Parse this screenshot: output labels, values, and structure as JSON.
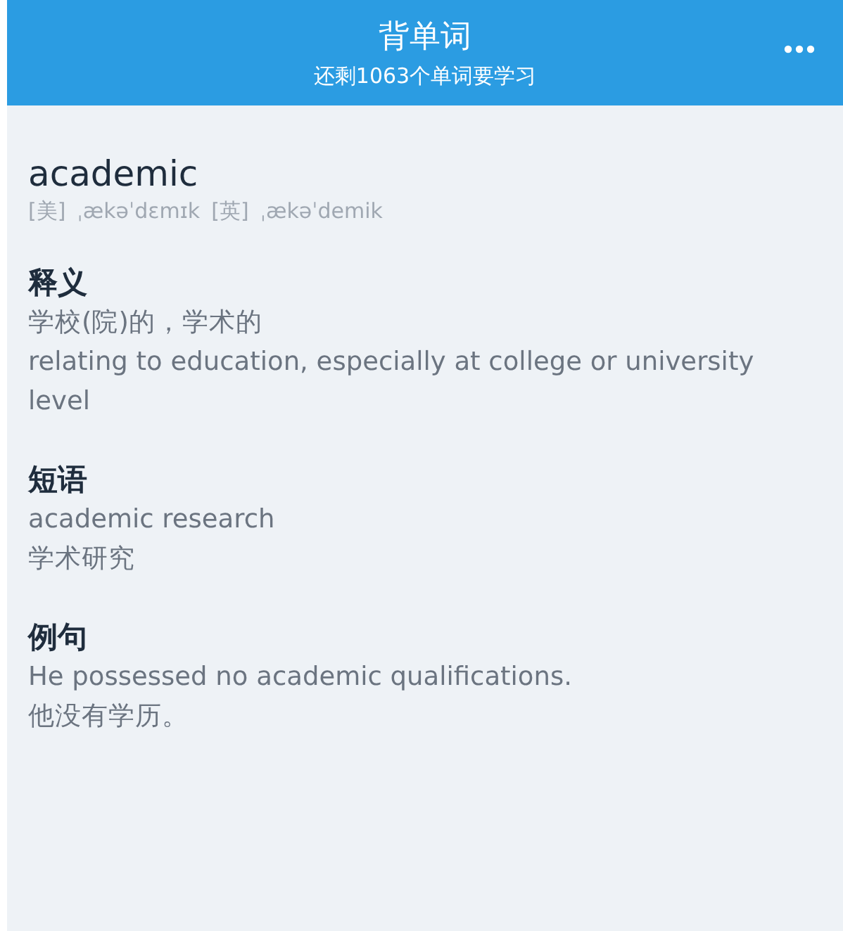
{
  "header": {
    "title": "背单词",
    "subtitle": "还剩1063个单词要学习"
  },
  "word": {
    "text": "academic",
    "phonetics": [
      {
        "region": "[美]",
        "ipa": "ˌækəˈdɛmɪk"
      },
      {
        "region": "[英]",
        "ipa": "ˌækəˈdemik"
      }
    ]
  },
  "sections": [
    {
      "title": "释义",
      "lines": [
        "学校(院)的，学术的",
        "relating to education, especially at college or university level"
      ]
    },
    {
      "title": "短语",
      "lines": [
        "academic research",
        "学术研究"
      ]
    },
    {
      "title": "例句",
      "lines": [
        "He possessed no academic qualifications.",
        "他没有学历。"
      ]
    }
  ]
}
